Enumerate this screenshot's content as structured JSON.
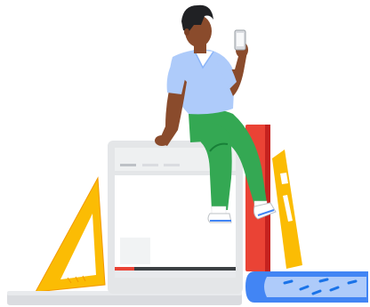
{
  "illustration": {
    "subject": "person-sitting-on-laptop",
    "colors": {
      "laptop_body": "#e4e6e8",
      "laptop_screen": "#ffffff",
      "laptop_toolbar": "#dadce0",
      "progress_track": "#3c4043",
      "progress_fill": "#ea4335",
      "book_red": "#ea4335",
      "ruler_yellow": "#fbbc04",
      "book_blue": "#4285f4",
      "shirt": "#aecbfa",
      "pants": "#34a853",
      "skin": "#8a4b2c",
      "hair": "#202124"
    },
    "icons": [
      "phone-icon",
      "play-progress-bar"
    ]
  }
}
